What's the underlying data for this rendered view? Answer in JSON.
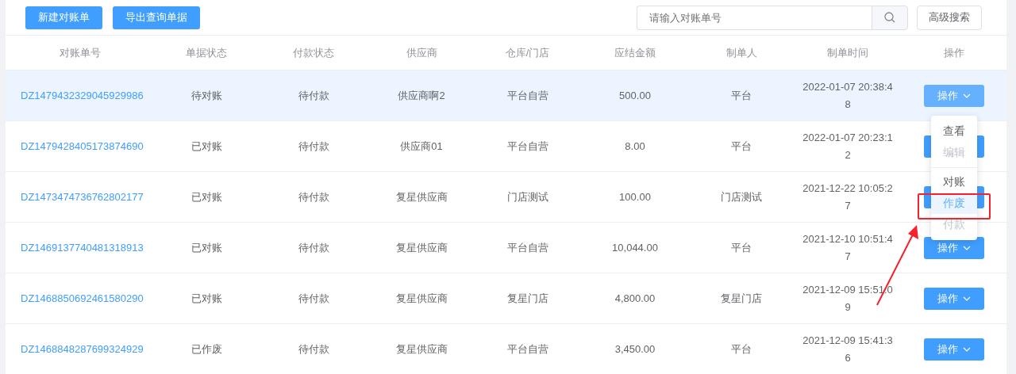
{
  "toolbar": {
    "buttons": [
      "新建对账单",
      "导出查询单据"
    ],
    "search": {
      "placeholder": "请输入对账单号"
    },
    "advanced_button": "高级搜索"
  },
  "table": {
    "columns": [
      "对账单号",
      "单据状态",
      "付款状态",
      "供应商",
      "仓库/门店",
      "应结金额",
      "制单人",
      "制单时间",
      "操作"
    ],
    "rows": [
      {
        "highlighted": true,
        "cells": [
          "DZ1479432329045929986",
          "待对账",
          "待付款",
          "供应商啊2",
          "平台自营",
          "500.00",
          "平台",
          "2022-01-07 20:38:48"
        ],
        "action": "操作"
      },
      {
        "highlighted": false,
        "cells": [
          "DZ1479428405173874690",
          "已对账",
          "待付款",
          "供应商01",
          "平台自营",
          "8.00",
          "平台",
          "2022-01-07 20:23:12"
        ]
      },
      {
        "highlighted": false,
        "cells": [
          "DZ1473474736762802177",
          "已对账",
          "待付款",
          "复星供应商",
          "门店测试",
          "100.00",
          "门店测试",
          "2021-12-22 10:05:27"
        ]
      },
      {
        "highlighted": false,
        "cells": [
          "DZ1469137740481318913",
          "已对账",
          "待付款",
          "复星供应商",
          "平台自营",
          "10,044.00",
          "平台",
          "2021-12-10 10:51:47"
        ],
        "action": "操作"
      },
      {
        "highlighted": false,
        "cells": [
          "DZ1468850692461580290",
          "已对账",
          "待付款",
          "复星供应商",
          "复星门店",
          "4,800.00",
          "复星门店",
          "2021-12-09 15:51:09"
        ],
        "action": "操作"
      },
      {
        "highlighted": false,
        "cells": [
          "DZ1468848287699324929",
          "已作废",
          "待付款",
          "复星供应商",
          "平台自营",
          "3,450.00",
          "平台",
          "2021-12-09 15:41:36"
        ],
        "action": "操作"
      }
    ]
  },
  "dropdown": {
    "items": [
      {
        "label": "查看",
        "disabled": false,
        "selected": false,
        "divided": false
      },
      {
        "label": "编辑",
        "disabled": true,
        "selected": false,
        "divided": false
      },
      {
        "label": "对账",
        "disabled": false,
        "selected": false,
        "divided": true
      },
      {
        "label": "作废",
        "disabled": false,
        "selected": true,
        "divided": false
      },
      {
        "label": "付款",
        "disabled": true,
        "selected": false,
        "divided": false
      }
    ]
  }
}
